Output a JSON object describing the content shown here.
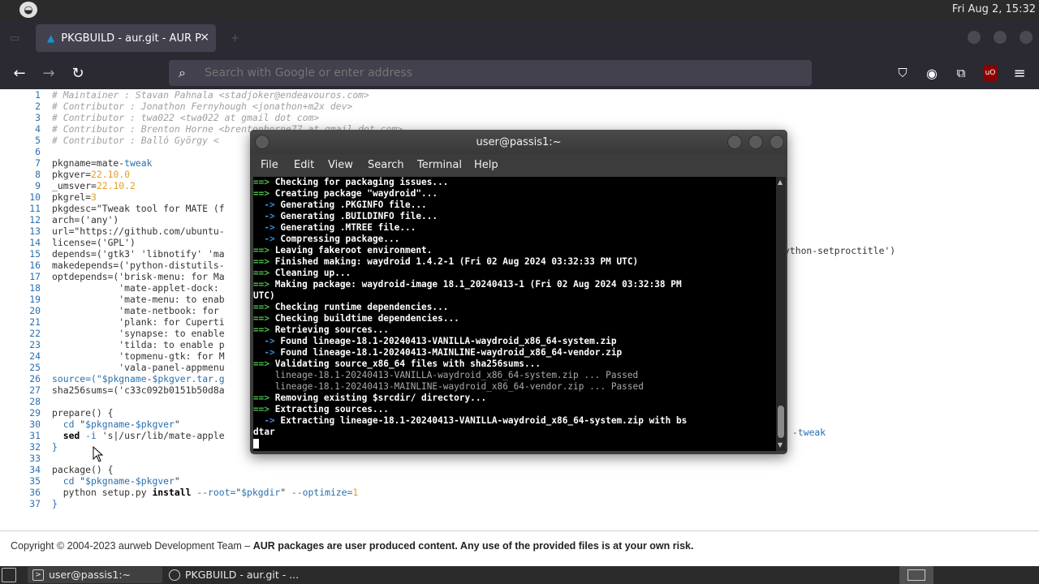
{
  "system_panel": {
    "clock": "Fri Aug  2, 15:32"
  },
  "browser": {
    "active_tab": {
      "title": "PKGBUILD - aur.git - AUR P",
      "close": "×"
    },
    "urlbar": {
      "placeholder": "Search with Google or enter address"
    },
    "icons": {
      "back": "←",
      "forward": "→",
      "reload": "↻",
      "pocket": "⛉",
      "account": "◉",
      "extensions": "⧉",
      "ublock": "uO",
      "menu": "≡",
      "search": "⌕"
    }
  },
  "code": {
    "lines": [
      {
        "n": "1",
        "parts": [
          {
            "t": "# Maintainer : Stavan Pahnala <stadjoker@endeavouros.com>",
            "c": "c-comment"
          }
        ]
      },
      {
        "n": "2",
        "parts": [
          {
            "t": "# Contributor : Jonathon Fernyhough <jonathon+m2x dev>",
            "c": "c-comment"
          }
        ]
      },
      {
        "n": "3",
        "parts": [
          {
            "t": "# Contributor : twa022 <twa022 at gmail dot com>",
            "c": "c-comment"
          }
        ]
      },
      {
        "n": "4",
        "parts": [
          {
            "t": "# Contributor : Brenton Horne <brentonhorne77 at gmail dot com>",
            "c": "c-comment"
          }
        ]
      },
      {
        "n": "5",
        "parts": [
          {
            "t": "# Contributor : Balló György <",
            "c": "c-comment"
          }
        ]
      },
      {
        "n": "6",
        "parts": []
      },
      {
        "n": "7",
        "parts": [
          {
            "t": "pkgname=mate-",
            "c": ""
          },
          {
            "t": "tweak",
            "c": "c-var"
          }
        ]
      },
      {
        "n": "8",
        "parts": [
          {
            "t": "pkgver=",
            "c": ""
          },
          {
            "t": "22.10.0",
            "c": "c-num"
          }
        ]
      },
      {
        "n": "9",
        "parts": [
          {
            "t": "_umsver=",
            "c": ""
          },
          {
            "t": "22.10.2",
            "c": "c-num"
          }
        ]
      },
      {
        "n": "10",
        "parts": [
          {
            "t": "pkgrel=",
            "c": ""
          },
          {
            "t": "3",
            "c": "c-num"
          }
        ]
      },
      {
        "n": "11",
        "parts": [
          {
            "t": "pkgdesc=\"Tweak tool for MATE (f",
            "c": ""
          }
        ]
      },
      {
        "n": "12",
        "parts": [
          {
            "t": "arch=('any')",
            "c": ""
          }
        ]
      },
      {
        "n": "13",
        "parts": [
          {
            "t": "url=\"https://github.com/ubuntu-",
            "c": ""
          }
        ]
      },
      {
        "n": "14",
        "parts": [
          {
            "t": "license=('GPL')",
            "c": ""
          }
        ]
      },
      {
        "n": "15",
        "parts": [
          {
            "t": "depends=('gtk3' 'libnotify' 'ma",
            "c": ""
          }
        ]
      },
      {
        "n": "16",
        "parts": [
          {
            "t": "makedepends=('python-distutils-",
            "c": ""
          }
        ]
      },
      {
        "n": "17",
        "parts": [
          {
            "t": "optdepends=('brisk-menu: for Ma",
            "c": ""
          }
        ]
      },
      {
        "n": "18",
        "parts": [
          {
            "t": "            'mate-applet-dock:",
            "c": ""
          }
        ]
      },
      {
        "n": "19",
        "parts": [
          {
            "t": "            'mate-menu: to enab",
            "c": ""
          }
        ]
      },
      {
        "n": "20",
        "parts": [
          {
            "t": "            'mate-netbook: for",
            "c": ""
          }
        ]
      },
      {
        "n": "21",
        "parts": [
          {
            "t": "            'plank: for Cuperti",
            "c": ""
          }
        ]
      },
      {
        "n": "22",
        "parts": [
          {
            "t": "            'synapse: to enable",
            "c": ""
          }
        ]
      },
      {
        "n": "23",
        "parts": [
          {
            "t": "            'tilda: to enable p",
            "c": ""
          }
        ]
      },
      {
        "n": "24",
        "parts": [
          {
            "t": "            'topmenu-gtk: for M",
            "c": ""
          }
        ]
      },
      {
        "n": "25",
        "parts": [
          {
            "t": "            'vala-panel-appmenu",
            "c": ""
          }
        ]
      },
      {
        "n": "26",
        "parts": [
          {
            "t": "source=(\"",
            "c": "c-var"
          },
          {
            "t": "$pkgname",
            "c": "c-var"
          },
          {
            "t": "-",
            "c": ""
          },
          {
            "t": "$pkgver",
            "c": "c-var"
          },
          {
            "t": ".tar.g",
            "c": "c-var"
          }
        ]
      },
      {
        "n": "27",
        "parts": [
          {
            "t": "sha256sums=('c33c092b0151b50d8a",
            "c": ""
          }
        ]
      },
      {
        "n": "28",
        "parts": []
      },
      {
        "n": "29",
        "parts": [
          {
            "t": "prepare() {",
            "c": ""
          }
        ]
      },
      {
        "n": "30",
        "parts": [
          {
            "t": "  cd ",
            "c": "c-var"
          },
          {
            "t": "\"",
            "c": ""
          },
          {
            "t": "$pkgname",
            "c": "c-var"
          },
          {
            "t": "-",
            "c": ""
          },
          {
            "t": "$pkgver",
            "c": "c-var"
          },
          {
            "t": "\"",
            "c": ""
          }
        ]
      },
      {
        "n": "31",
        "parts": [
          {
            "t": "  ",
            "c": ""
          },
          {
            "t": "sed",
            "c": "c-bold"
          },
          {
            "t": " -i",
            "c": "c-var"
          },
          {
            "t": " 's|/usr/lib/mate-apple",
            "c": ""
          }
        ]
      },
      {
        "n": "32",
        "parts": [
          {
            "t": "}",
            "c": "c-var"
          }
        ]
      },
      {
        "n": "33",
        "parts": []
      },
      {
        "n": "34",
        "parts": [
          {
            "t": "package() {",
            "c": ""
          }
        ]
      },
      {
        "n": "35",
        "parts": [
          {
            "t": "  cd ",
            "c": "c-var"
          },
          {
            "t": "\"",
            "c": ""
          },
          {
            "t": "$pkgname",
            "c": "c-var"
          },
          {
            "t": "-",
            "c": ""
          },
          {
            "t": "$pkgver",
            "c": "c-var"
          },
          {
            "t": "\"",
            "c": ""
          }
        ]
      },
      {
        "n": "36",
        "parts": [
          {
            "t": "  python setup.py ",
            "c": ""
          },
          {
            "t": "install",
            "c": "c-bold"
          },
          {
            "t": " --root=",
            "c": "c-var"
          },
          {
            "t": "\"",
            "c": ""
          },
          {
            "t": "$pkgdir",
            "c": "c-var"
          },
          {
            "t": "\"",
            "c": ""
          },
          {
            "t": " --optimize=",
            "c": "c-var"
          },
          {
            "t": "1",
            "c": "c-num"
          }
        ]
      },
      {
        "n": "37",
        "parts": [
          {
            "t": "}",
            "c": "c-var"
          }
        ]
      }
    ],
    "trail_line15": "ython-setproctitle')",
    "trail_line31": "-tweak"
  },
  "footer": {
    "prefix": "Copyright © 2004-2023 aurweb Development Team – ",
    "bold": "AUR packages are user produced content. Any use of the provided files is at your own risk."
  },
  "terminal": {
    "title": "user@passis1:~",
    "menu": [
      "File",
      "Edit",
      "View",
      "Search",
      "Terminal",
      "Help"
    ],
    "lines": [
      {
        "p": "==>",
        "pc": "arrg",
        "t": " Checking for packaging issues..."
      },
      {
        "p": "==>",
        "pc": "arrg",
        "t": " Creating package \"waydroid\"..."
      },
      {
        "p": "  ->",
        "pc": "arr",
        "t": " Generating .PKGINFO file..."
      },
      {
        "p": "  ->",
        "pc": "arr",
        "t": " Generating .BUILDINFO file..."
      },
      {
        "p": "  ->",
        "pc": "arr",
        "t": " Generating .MTREE file..."
      },
      {
        "p": "  ->",
        "pc": "arr",
        "t": " Compressing package..."
      },
      {
        "p": "==>",
        "pc": "arrg",
        "t": " Leaving fakeroot environment."
      },
      {
        "p": "==>",
        "pc": "arrg",
        "t": " Finished making: waydroid 1.4.2-1 (Fri 02 Aug 2024 03:32:33 PM UTC)"
      },
      {
        "p": "==>",
        "pc": "arrg",
        "t": " Cleaning up..."
      },
      {
        "p": "==>",
        "pc": "arrg",
        "t": " Making package: waydroid-image 18.1_20240413-1 (Fri 02 Aug 2024 03:32:38 PM"
      },
      {
        "p": "",
        "pc": "",
        "t": "UTC)"
      },
      {
        "p": "==>",
        "pc": "arrg",
        "t": " Checking runtime dependencies..."
      },
      {
        "p": "==>",
        "pc": "arrg",
        "t": " Checking buildtime dependencies..."
      },
      {
        "p": "==>",
        "pc": "arrg",
        "t": " Retrieving sources..."
      },
      {
        "p": "  ->",
        "pc": "arr",
        "t": " Found lineage-18.1-20240413-VANILLA-waydroid_x86_64-system.zip"
      },
      {
        "p": "  ->",
        "pc": "arr",
        "t": " Found lineage-18.1-20240413-MAINLINE-waydroid_x86_64-vendor.zip"
      },
      {
        "p": "==>",
        "pc": "arrg",
        "t": " Validating source_x86_64 files with sha256sums..."
      },
      {
        "p": "",
        "pc": "",
        "t": "    lineage-18.1-20240413-VANILLA-waydroid_x86_64-system.zip ... Passed",
        "dim": true
      },
      {
        "p": "",
        "pc": "",
        "t": "    lineage-18.1-20240413-MAINLINE-waydroid_x86_64-vendor.zip ... Passed",
        "dim": true
      },
      {
        "p": "==>",
        "pc": "arrg",
        "t": " Removing existing $srcdir/ directory..."
      },
      {
        "p": "==>",
        "pc": "arrg",
        "t": " Extracting sources..."
      },
      {
        "p": "  ->",
        "pc": "arr",
        "t": " Extracting lineage-18.1-20240413-VANILLA-waydroid_x86_64-system.zip with bs"
      },
      {
        "p": "",
        "pc": "",
        "t": "dtar"
      }
    ]
  },
  "taskbar": {
    "task1": "user@passis1:~",
    "task2": "PKGBUILD - aur.git - ..."
  }
}
